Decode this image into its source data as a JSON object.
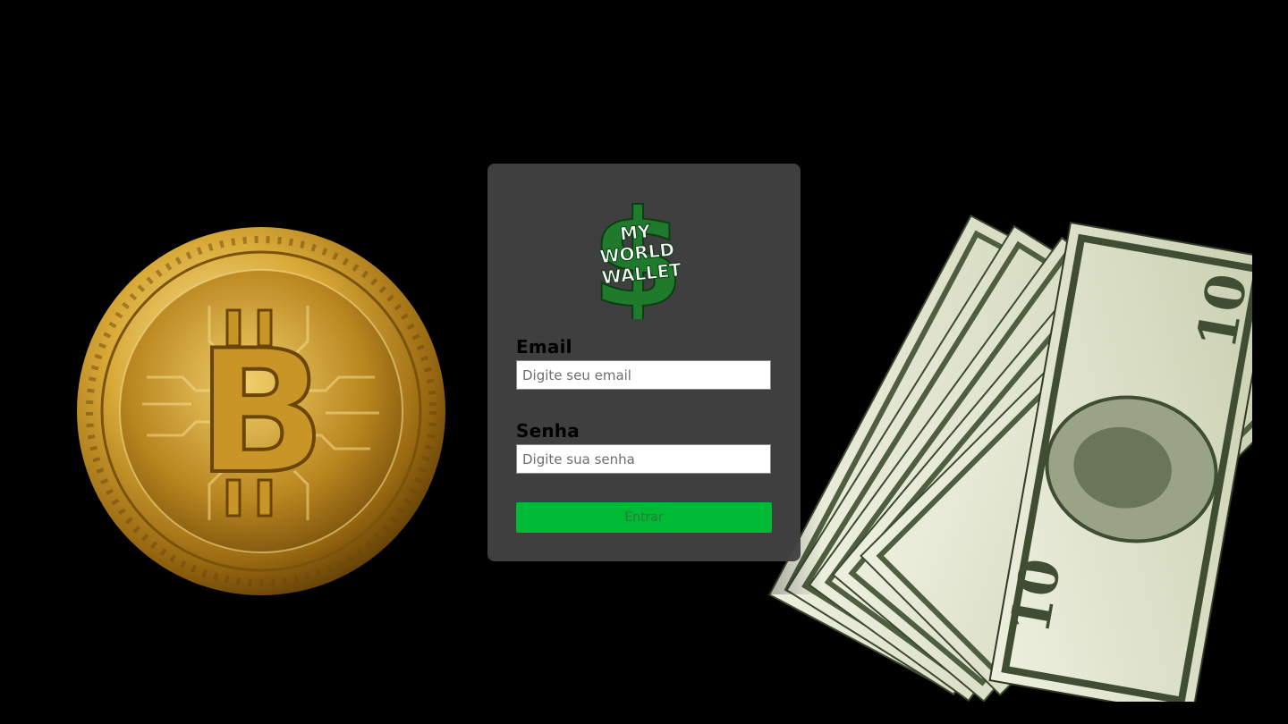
{
  "logo": {
    "line1": "MY",
    "line2": "WORLD",
    "line3": "WALLET",
    "glyph": "$"
  },
  "form": {
    "email_label": "Email",
    "email_placeholder": "Digite seu email",
    "email_value": "",
    "password_label": "Senha",
    "password_placeholder": "Digite sua senha",
    "password_value": "",
    "submit_label": "Entrar"
  },
  "decor": {
    "coin_icon": "bitcoin-coin-icon",
    "bills_icon": "dollar-bills-icon"
  },
  "colors": {
    "background": "#000000",
    "card": "#424242",
    "accent": "#00b934",
    "logo_green": "#1f7a2c",
    "coin_gold": "#d4a532"
  }
}
